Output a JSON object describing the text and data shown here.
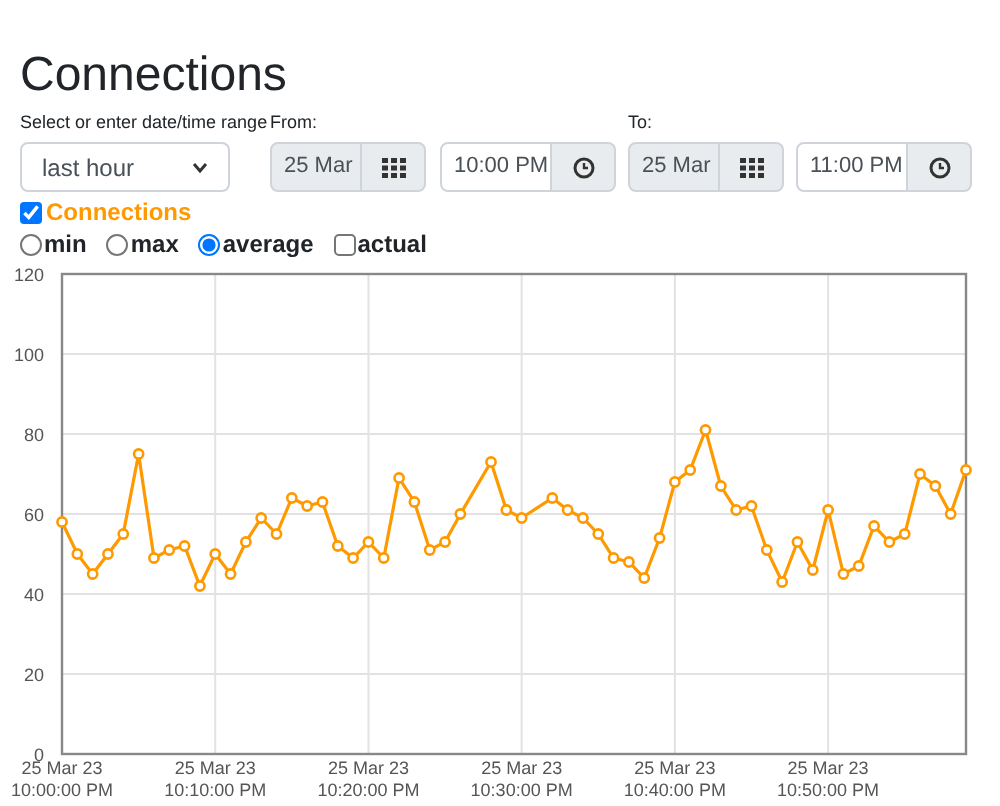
{
  "title": "Connections",
  "range": {
    "label": "Select or enter date/time range",
    "value": "last hour"
  },
  "from": {
    "label": "From:",
    "date": "25 Mar",
    "time": "10:00 PM"
  },
  "to": {
    "label": "To:",
    "date": "25 Mar",
    "time": "11:00 PM"
  },
  "series_toggle": {
    "checked": true
  },
  "modes": [
    {
      "label": "min",
      "kind": "radio",
      "selected": false
    },
    {
      "label": "max",
      "kind": "radio",
      "selected": false
    },
    {
      "label": "average",
      "kind": "radio",
      "selected": true
    },
    {
      "label": "actual",
      "kind": "checkbox",
      "selected": false
    }
  ],
  "chart_data": {
    "type": "line",
    "categories": [
      "25 Mar 23\n10:00:00 PM",
      null,
      null,
      null,
      null,
      null,
      null,
      null,
      null,
      null,
      "25 Mar 23\n10:10:00 PM",
      null,
      null,
      null,
      null,
      null,
      null,
      null,
      null,
      null,
      "25 Mar 23\n10:20:00 PM",
      null,
      null,
      null,
      null,
      null,
      null,
      null,
      null,
      null,
      "25 Mar 23\n10:30:00 PM",
      null,
      null,
      null,
      null,
      null,
      null,
      null,
      null,
      null,
      "25 Mar 23\n10:40:00 PM",
      null,
      null,
      null,
      null,
      null,
      null,
      null,
      null,
      null,
      "25 Mar 23\n10:50:00 PM",
      null,
      null,
      null,
      null,
      null,
      null,
      null,
      null,
      null
    ],
    "series": [
      {
        "name": "Connections",
        "color": "#ff9900",
        "marker": "circle",
        "values": [
          58,
          50,
          45,
          50,
          55,
          75,
          49,
          51,
          52,
          42,
          50,
          45,
          53,
          59,
          55,
          64,
          62,
          63,
          52,
          49,
          53,
          49,
          69,
          63,
          51,
          53,
          60,
          null,
          73,
          61,
          59,
          null,
          64,
          61,
          59,
          55,
          49,
          48,
          44,
          54,
          68,
          71,
          81,
          67,
          61,
          62,
          51,
          43,
          53,
          46,
          61,
          45,
          47,
          57,
          53,
          55,
          70,
          67,
          60,
          71
        ]
      }
    ],
    "grid": true,
    "ylim": [
      0,
      120
    ],
    "yticks": [
      0,
      20,
      40,
      60,
      80,
      100,
      120
    ]
  }
}
